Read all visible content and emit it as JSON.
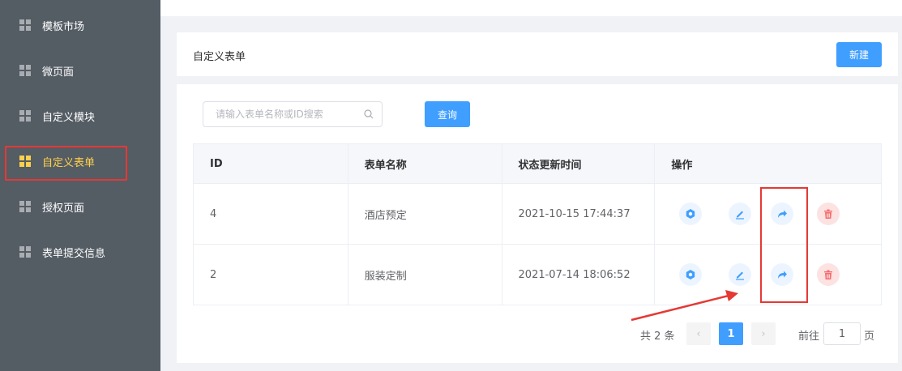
{
  "sidebar": {
    "items": [
      {
        "label": "模板市场",
        "active": false
      },
      {
        "label": "微页面",
        "active": false
      },
      {
        "label": "自定义模块",
        "active": false
      },
      {
        "label": "自定义表单",
        "active": true
      },
      {
        "label": "授权页面",
        "active": false
      },
      {
        "label": "表单提交信息",
        "active": false
      }
    ]
  },
  "header": {
    "title": "自定义表单",
    "new_button": "新建"
  },
  "search": {
    "placeholder": "请输入表单名称或ID搜索",
    "value": "",
    "query_button": "查询"
  },
  "table": {
    "columns": [
      "ID",
      "表单名称",
      "状态更新时间",
      "操作"
    ],
    "rows": [
      {
        "id": "4",
        "name": "酒店预定",
        "updated": "2021-10-15 17:44:37"
      },
      {
        "id": "2",
        "name": "服装定制",
        "updated": "2021-07-14 18:06:52"
      }
    ],
    "action_icons": [
      "settings-icon",
      "edit-icon",
      "share-icon",
      "delete-icon"
    ]
  },
  "pagination": {
    "total_text": "共 2 条",
    "current_page": "1",
    "prev_symbol": "‹",
    "next_symbol": "›",
    "goto_prefix": "前往",
    "goto_value": "1",
    "goto_suffix": "页"
  },
  "colors": {
    "sidebar_bg": "#545c64",
    "active": "#ffd04b",
    "primary": "#409eff",
    "danger": "#f56c6c",
    "highlight": "#e53935"
  }
}
